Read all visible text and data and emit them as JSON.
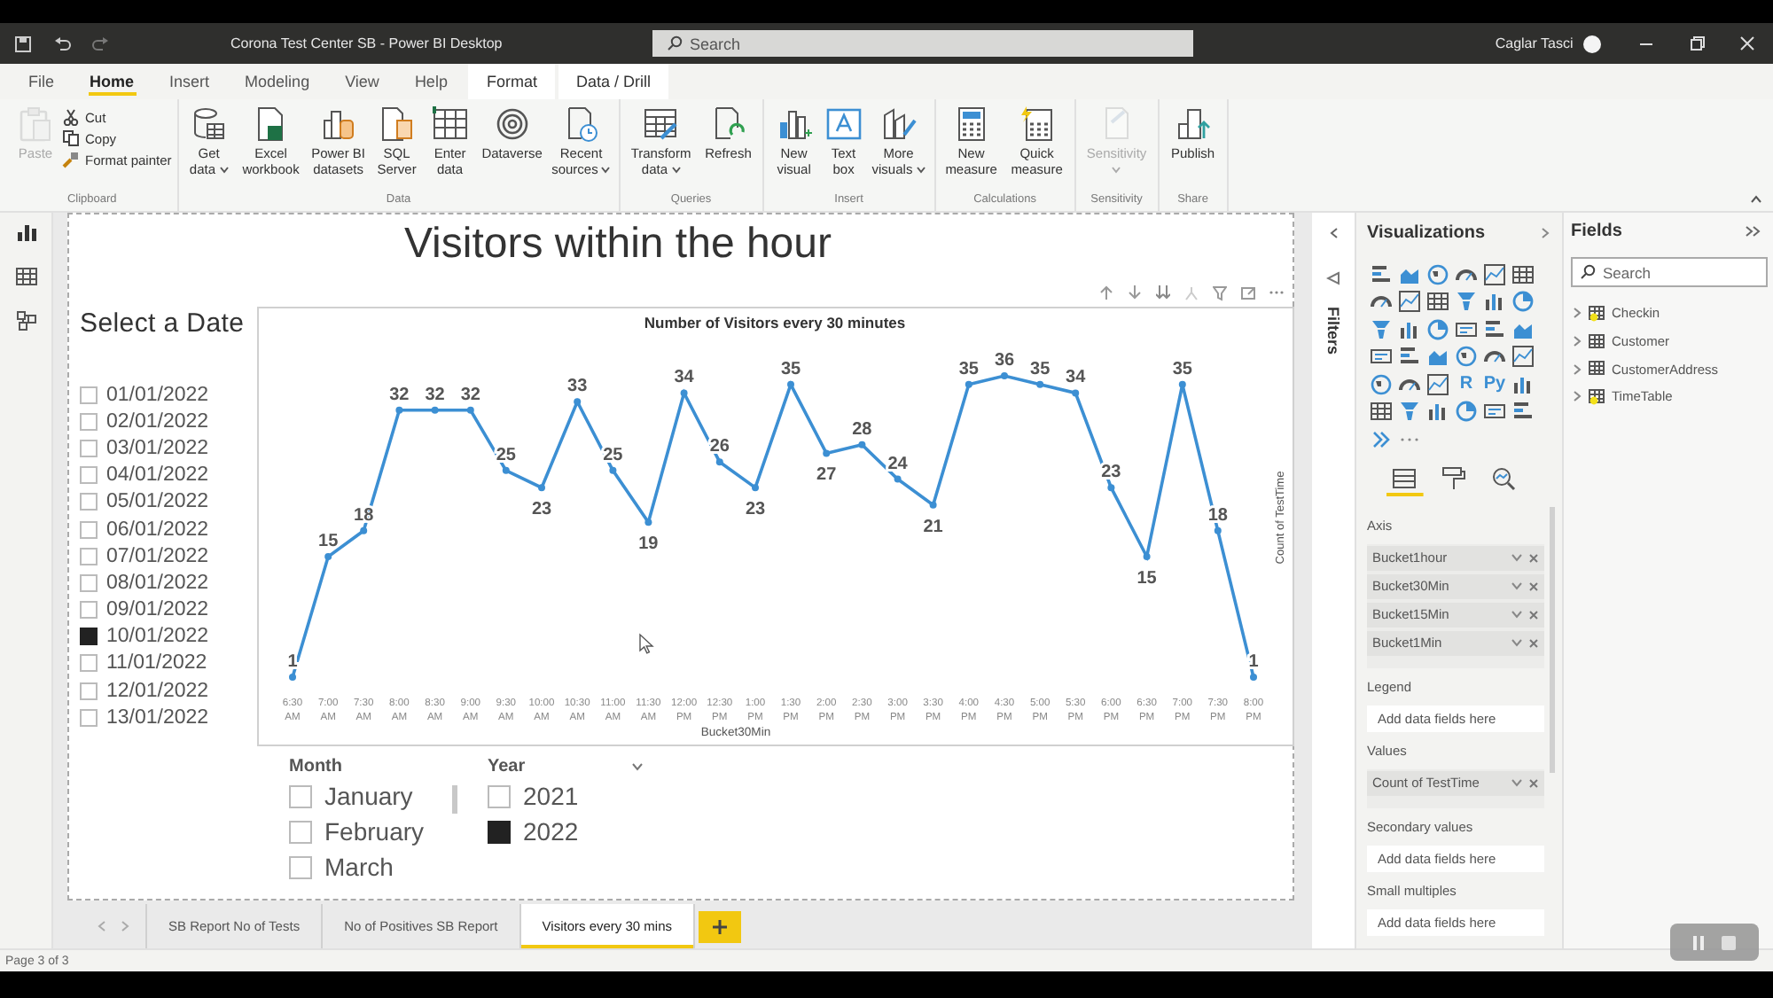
{
  "window": {
    "title": "Corona Test Center SB - Power BI Desktop",
    "search_placeholder": "Search",
    "user": "Caglar Tasci"
  },
  "ribbon_tabs": [
    {
      "label": "File",
      "selected": false,
      "contextual": false
    },
    {
      "label": "Home",
      "selected": true,
      "contextual": false
    },
    {
      "label": "Insert",
      "selected": false,
      "contextual": false
    },
    {
      "label": "Modeling",
      "selected": false,
      "contextual": false
    },
    {
      "label": "View",
      "selected": false,
      "contextual": false
    },
    {
      "label": "Help",
      "selected": false,
      "contextual": false
    },
    {
      "label": "Format",
      "selected": false,
      "contextual": true
    },
    {
      "label": "Data / Drill",
      "selected": false,
      "contextual": true
    }
  ],
  "ribbon_groups": [
    {
      "label": "Clipboard",
      "buttons": [
        {
          "kind": "paste",
          "label": "Paste",
          "disabled": true
        },
        {
          "kind": "cut",
          "label": "Cut"
        },
        {
          "kind": "copy",
          "label": "Copy"
        },
        {
          "kind": "painter",
          "label": "Format painter"
        }
      ]
    },
    {
      "label": "Data",
      "buttons": [
        {
          "kind": "getdata",
          "label": "Get data",
          "dropdown": true
        },
        {
          "kind": "excel",
          "label": "Excel workbook"
        },
        {
          "kind": "pbids",
          "label": "Power BI datasets"
        },
        {
          "kind": "sql",
          "label": "SQL Server"
        },
        {
          "kind": "enter",
          "label": "Enter data"
        },
        {
          "kind": "dataverse",
          "label": "Dataverse"
        },
        {
          "kind": "recent",
          "label": "Recent sources",
          "dropdown": true
        }
      ]
    },
    {
      "label": "Queries",
      "buttons": [
        {
          "kind": "transform",
          "label": "Transform data",
          "dropdown": true
        },
        {
          "kind": "refresh",
          "label": "Refresh"
        }
      ]
    },
    {
      "label": "Insert",
      "buttons": [
        {
          "kind": "newvisual",
          "label": "New visual"
        },
        {
          "kind": "textbox",
          "label": "Text box"
        },
        {
          "kind": "morevisuals",
          "label": "More visuals",
          "dropdown": true
        }
      ]
    },
    {
      "label": "Calculations",
      "buttons": [
        {
          "kind": "newmeasure",
          "label": "New measure"
        },
        {
          "kind": "quickmeasure",
          "label": "Quick measure"
        }
      ]
    },
    {
      "label": "Sensitivity",
      "buttons": [
        {
          "kind": "sensitivity",
          "label": "Sensitivity",
          "disabled": true,
          "dropdown": true
        }
      ]
    },
    {
      "label": "Share",
      "buttons": [
        {
          "kind": "publish",
          "label": "Publish"
        }
      ]
    }
  ],
  "report": {
    "title": "Visitors within the hour",
    "date_slicer": {
      "title": "Select a Date",
      "items": [
        {
          "label": "01/01/2022",
          "checked": false
        },
        {
          "label": "02/01/2022",
          "checked": false
        },
        {
          "label": "03/01/2022",
          "checked": false
        },
        {
          "label": "04/01/2022",
          "checked": false
        },
        {
          "label": "05/01/2022",
          "checked": false
        },
        {
          "label": "06/01/2022",
          "checked": false
        },
        {
          "label": "07/01/2022",
          "checked": false
        },
        {
          "label": "08/01/2022",
          "checked": false
        },
        {
          "label": "09/01/2022",
          "checked": false
        },
        {
          "label": "10/01/2022",
          "checked": true
        },
        {
          "label": "11/01/2022",
          "checked": false
        },
        {
          "label": "12/01/2022",
          "checked": false
        },
        {
          "label": "13/01/2022",
          "checked": false
        }
      ]
    },
    "chart": {
      "chart_data": {
        "type": "line",
        "title": "Number of Visitors every 30 minutes",
        "xlabel": "Bucket30Min",
        "ylabel": "Count of TestTime",
        "data_labels": true,
        "categories": [
          "6:30 AM",
          "7:00 AM",
          "7:30 AM",
          "8:00 AM",
          "8:30 AM",
          "9:00 AM",
          "9:30 AM",
          "10:00 AM",
          "10:30 AM",
          "11:00 AM",
          "11:30 AM",
          "12:00 PM",
          "12:30 PM",
          "1:00 PM",
          "1:30 PM",
          "2:00 PM",
          "2:30 PM",
          "3:00 PM",
          "3:30 PM",
          "4:00 PM",
          "4:30 PM",
          "5:00 PM",
          "5:30 PM",
          "6:00 PM",
          "6:30 PM",
          "7:00 PM",
          "7:30 PM",
          "8:00 PM"
        ],
        "series": [
          {
            "color": "#3c8fd3",
            "marker": true,
            "values": [
              1,
              15,
              18,
              32,
              32,
              32,
              25,
              23,
              33,
              25,
              19,
              34,
              26,
              23,
              35,
              27,
              28,
              24,
              21,
              35,
              36,
              35,
              34,
              23,
              15,
              35,
              18,
              1
            ]
          }
        ]
      }
    },
    "month_slicer": {
      "title": "Month",
      "items": [
        {
          "label": "January",
          "checked": false
        },
        {
          "label": "February",
          "checked": false
        },
        {
          "label": "March",
          "checked": false
        }
      ]
    },
    "year_slicer": {
      "title": "Year",
      "items": [
        {
          "label": "2021",
          "checked": false
        },
        {
          "label": "2022",
          "checked": true
        }
      ]
    }
  },
  "filters": {
    "label": "Filters"
  },
  "visualizations": {
    "title": "Visualizations",
    "script_visuals": [
      "R",
      "Py"
    ],
    "tabs": [
      {
        "kind": "fields",
        "selected": true
      },
      {
        "kind": "format",
        "selected": false
      },
      {
        "kind": "analytics",
        "selected": false
      }
    ],
    "wells": [
      {
        "title": "Axis",
        "fields": [
          "Bucket1hour",
          "Bucket30Min",
          "Bucket15Min",
          "Bucket1Min"
        ]
      },
      {
        "title": "Legend",
        "placeholder": "Add data fields here"
      },
      {
        "title": "Values",
        "fields": [
          "Count of TestTime"
        ]
      },
      {
        "title": "Secondary values",
        "placeholder": "Add data fields here"
      },
      {
        "title": "Small multiples",
        "placeholder": "Add data fields here"
      }
    ]
  },
  "fields": {
    "title": "Fields",
    "search_placeholder": "Search",
    "tables": [
      {
        "name": "Checkin",
        "marked": true
      },
      {
        "name": "Customer",
        "marked": false
      },
      {
        "name": "CustomerAddress",
        "marked": false
      },
      {
        "name": "TimeTable",
        "marked": true
      }
    ]
  },
  "page_tabs": [
    {
      "label": "SB Report No of Tests",
      "selected": false
    },
    {
      "label": "No of Positives SB Report",
      "selected": false
    },
    {
      "label": "Visitors every 30 mins",
      "selected": true
    }
  ],
  "status_bar": "Page 3 of 3"
}
